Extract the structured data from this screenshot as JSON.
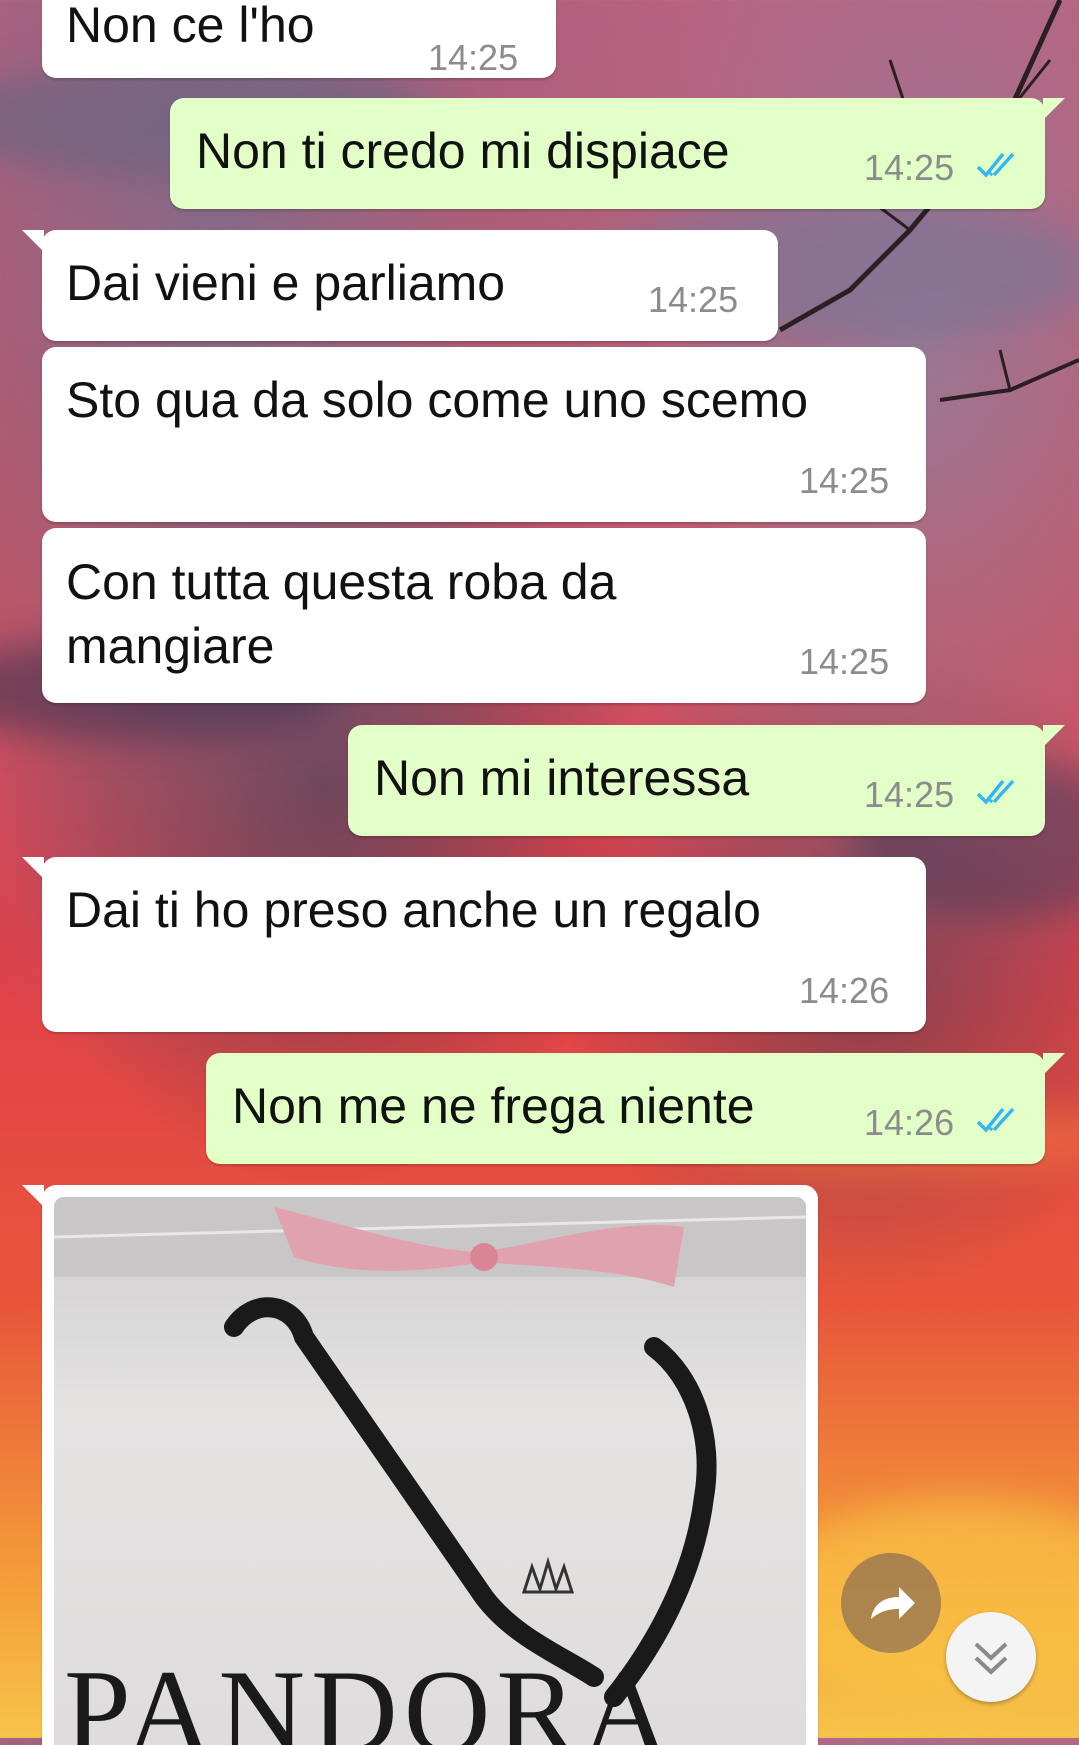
{
  "colors": {
    "incoming_bubble": "#ffffff",
    "outgoing_bubble": "#e1ffc7",
    "timestamp": "#8c8c8c",
    "read_ticks": "#34b7f1"
  },
  "messages": [
    {
      "direction": "in",
      "text": "Non ce l'ho",
      "time": "14:25"
    },
    {
      "direction": "out",
      "text": "Non ti credo mi dispiace",
      "time": "14:25",
      "status": "read"
    },
    {
      "direction": "in",
      "text": "Dai vieni e parliamo",
      "time": "14:25"
    },
    {
      "direction": "in",
      "text": "Sto qua da solo come uno scemo",
      "time": "14:25"
    },
    {
      "direction": "in",
      "text": "Con tutta questa roba da\nmangiare",
      "time": "14:25"
    },
    {
      "direction": "out",
      "text": "Non mi interessa",
      "time": "14:25",
      "status": "read"
    },
    {
      "direction": "in",
      "text": "Dai ti ho preso anche un regalo",
      "time": "14:26"
    },
    {
      "direction": "out",
      "text": "Non me ne frega niente",
      "time": "14:26",
      "status": "read"
    },
    {
      "direction": "in",
      "type": "image",
      "image_text": "PANDORA"
    }
  ],
  "icons": {
    "read_ticks": "double-check-icon",
    "forward": "forward-arrow-icon",
    "scroll_down": "chevron-double-down-icon"
  }
}
